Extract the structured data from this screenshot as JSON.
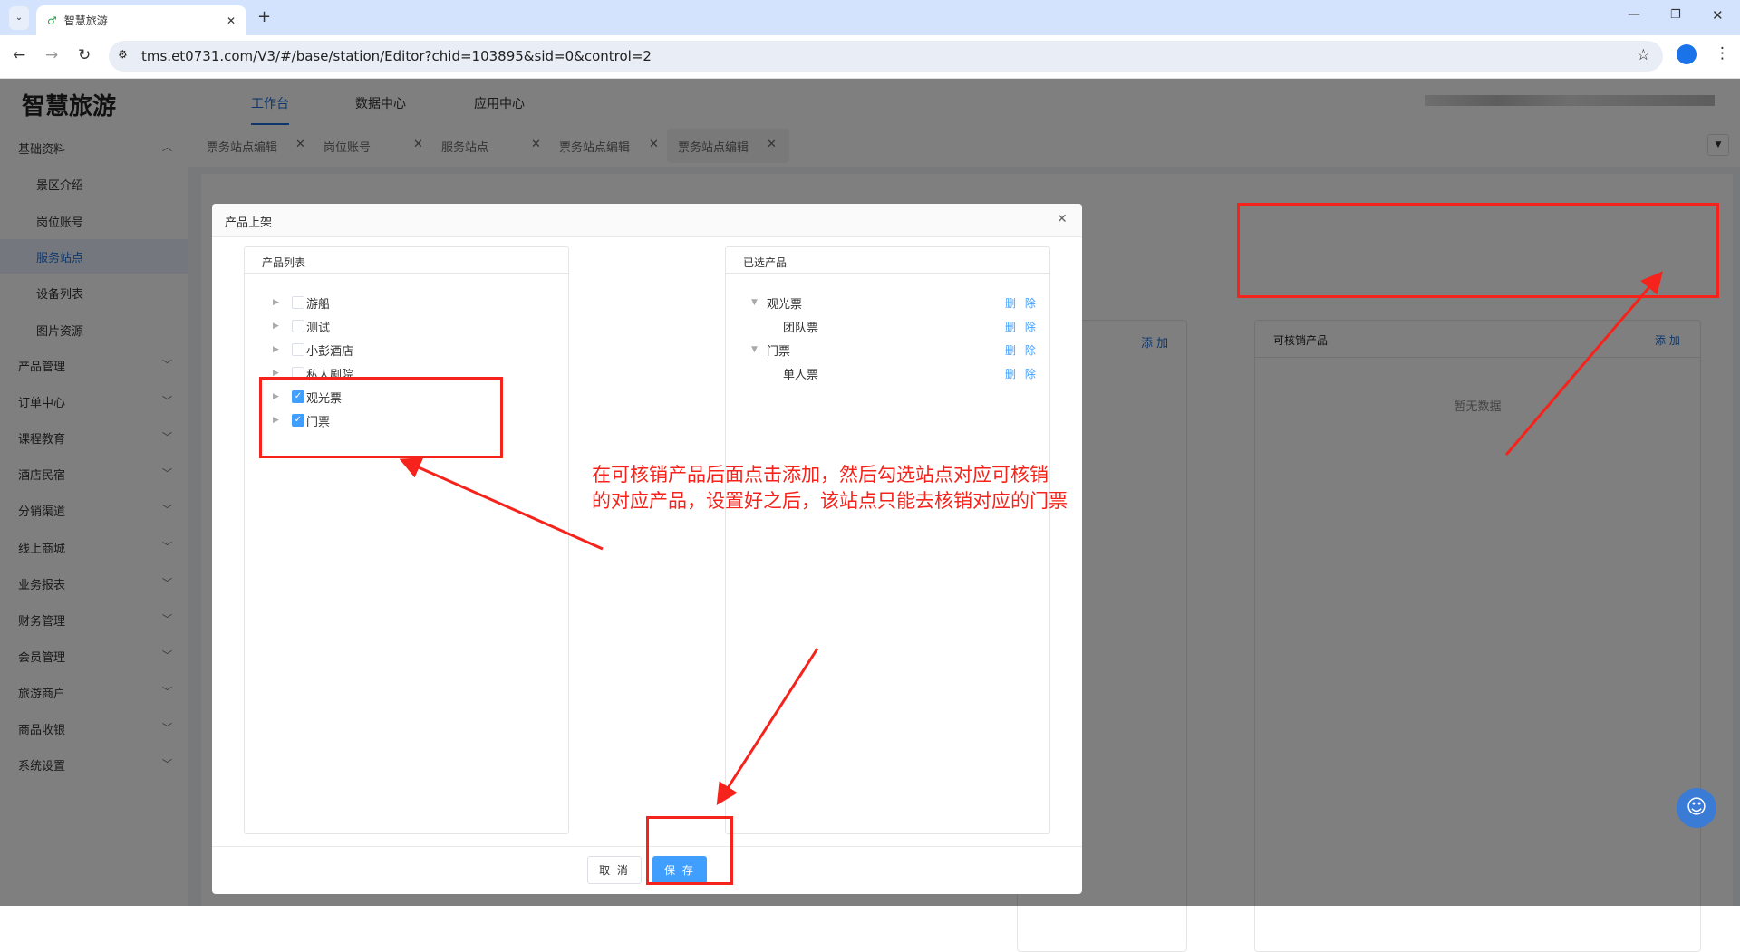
{
  "browser": {
    "tab_title": "智慧旅游",
    "url": "tms.et0731.com/V3/#/base/station/Editor?chid=103895&sid=0&control=2"
  },
  "header": {
    "logo": "智慧旅游",
    "nav": [
      "工作台",
      "数据中心",
      "应用中心"
    ]
  },
  "sidebar": {
    "group": "基础资料",
    "sub": [
      "景区介绍",
      "岗位账号",
      "服务站点",
      "设备列表",
      "图片资源"
    ],
    "groups": [
      "产品管理",
      "订单中心",
      "课程教育",
      "酒店民宿",
      "分销渠道",
      "线上商城",
      "业务报表",
      "财务管理",
      "会员管理",
      "旅游商户",
      "商品收银",
      "系统设置"
    ]
  },
  "page_tabs": [
    "票务站点编辑",
    "岗位账号",
    "服务站点",
    "票务站点编辑",
    "票务站点编辑"
  ],
  "background": {
    "add_label": "添 加",
    "card_title": "可核销产品",
    "empty": "暂无数据"
  },
  "modal": {
    "title": "产品上架",
    "left_title": "产品列表",
    "items": [
      {
        "label": "游船",
        "checked": false
      },
      {
        "label": "测试",
        "checked": false
      },
      {
        "label": "小彭酒店",
        "checked": false
      },
      {
        "label": "私人剧院",
        "checked": false
      },
      {
        "label": "观光票",
        "checked": true
      },
      {
        "label": "门票",
        "checked": true
      }
    ],
    "right_title": "已选产品",
    "selected": [
      {
        "label": "观光票",
        "level": 0
      },
      {
        "label": "团队票",
        "level": 1
      },
      {
        "label": "门票",
        "level": 0
      },
      {
        "label": "单人票",
        "level": 1
      }
    ],
    "delete_label": "删 除",
    "cancel": "取 消",
    "save": "保 存"
  },
  "annotation": {
    "line1": "在可核销产品后面点击添加，然后勾选站点对应可核销",
    "line2": "的对应产品，设置好之后，该站点只能去核销对应的门票"
  },
  "colors": {
    "accent": "#409eff",
    "annotation": "#f5231b"
  }
}
